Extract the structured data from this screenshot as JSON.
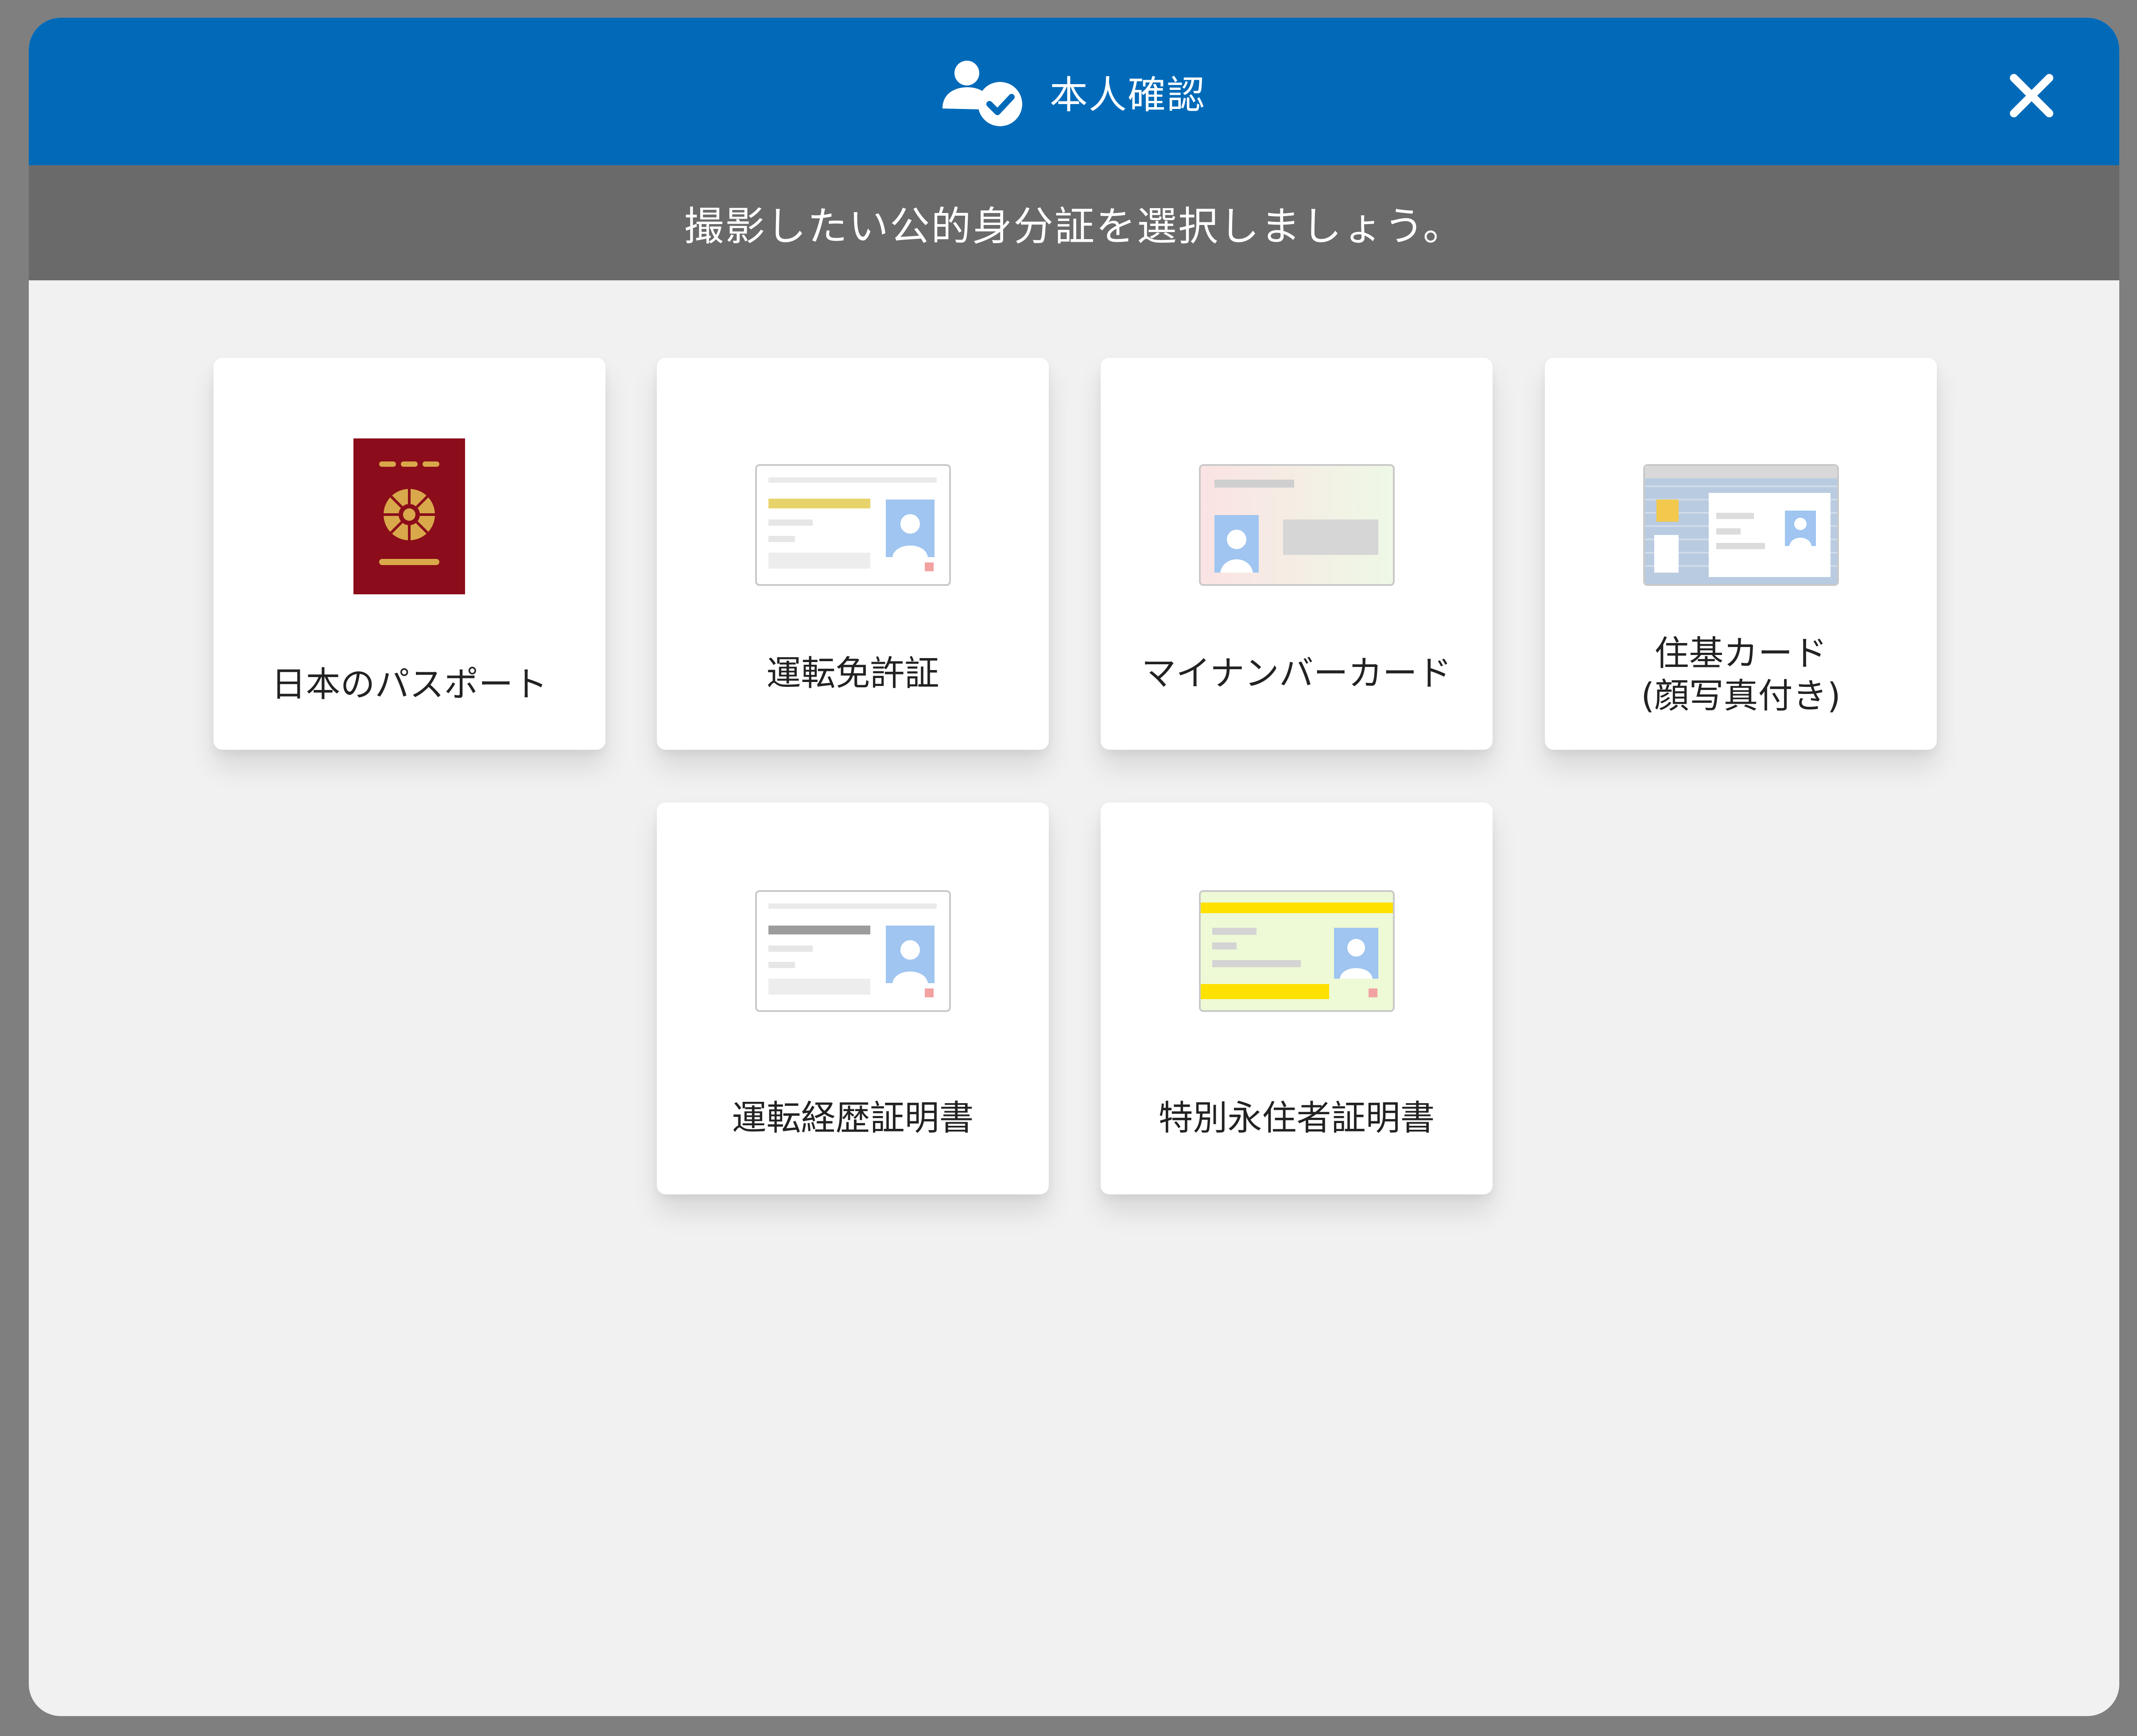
{
  "header": {
    "title": "本人確認",
    "background": "#006ab9",
    "icons": {
      "user_check": "user-check-icon",
      "close": "close-icon"
    }
  },
  "instruction": {
    "text": "撮影したい公的身分証を選択しましょう。",
    "background": "#6a6a6a"
  },
  "documents": [
    {
      "label": "日本のパスポート",
      "icon": "passport-icon"
    },
    {
      "label": "運転免許証",
      "icon": "drivers-license-icon"
    },
    {
      "label": "マイナンバーカード",
      "icon": "my-number-card-icon"
    },
    {
      "label": "住基カード\n(顔写真付き)",
      "icon": "juki-card-icon"
    },
    {
      "label": "運転経歴証明書",
      "icon": "driving-history-certificate-icon"
    },
    {
      "label": "特別永住者証明書",
      "icon": "special-permanent-resident-certificate-icon"
    }
  ],
  "colors": {
    "passport": "#8b0c1a",
    "gold": "#d9a84a",
    "license_bar": "#e8d36b",
    "photo_blue": "#9fc5f0",
    "mynumber_pink": "#fbe3e3",
    "resident_green": "#eef9d6",
    "resident_yellow": "#ffe100"
  }
}
